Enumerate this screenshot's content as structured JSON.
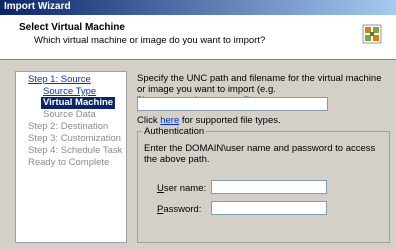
{
  "window": {
    "title": "Import Wizard"
  },
  "header": {
    "title": "Select Virtual Machine",
    "subtitle": "Which virtual machine or image do you want to import?",
    "icon": "vmware-converter-icon"
  },
  "nav": {
    "items": [
      {
        "label": "Step 1: Source",
        "state": "link"
      },
      {
        "label": "Source Type",
        "state": "link"
      },
      {
        "label": "Virtual Machine",
        "state": "selected"
      },
      {
        "label": "Source Data",
        "state": "disabled"
      },
      {
        "label": "Step 2: Destination",
        "state": "disabled"
      },
      {
        "label": "Step 3: Customization",
        "state": "disabled"
      },
      {
        "label": "Step 4: Schedule Task",
        "state": "disabled"
      },
      {
        "label": "Ready to Complete",
        "state": "disabled"
      }
    ]
  },
  "main": {
    "instruction": "Specify the UNC path and filename for the virtual machine or image you want to import (e.g. \"\\\\servername\\myvm.vmx\").",
    "unc_value": "",
    "help_prefix": "Click ",
    "help_link": "here",
    "help_suffix": " for supported file types."
  },
  "auth": {
    "legend": "Authentication",
    "description": "Enter the DOMAIN\\user name and password to access the above path.",
    "username_label_u": "U",
    "username_label_rest": "ser name:",
    "username_value": "",
    "password_label_u": "P",
    "password_label_rest": "assword:",
    "password_value": ""
  },
  "colors": {
    "titlebar_start": "#0a246a",
    "titlebar_end": "#a6caf0",
    "link": "#0033cc",
    "selected_bg": "#0a246a",
    "disabled_text": "#8a8a8a"
  }
}
